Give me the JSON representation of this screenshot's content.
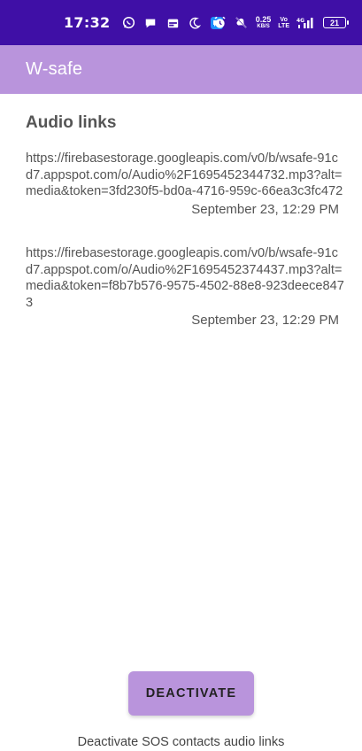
{
  "status_bar": {
    "time": "17:32",
    "net_speed_value": "0.25",
    "net_speed_unit": "KB/S",
    "lte_top": "Vo",
    "lte_bottom": "LTE",
    "signal_label": "4G",
    "battery": "21",
    "icons": [
      "whatsapp-icon",
      "chat-bubble-icon",
      "calendar-icon",
      "moon-icon",
      "message-icon",
      "dot-icon",
      "alarm-icon",
      "mute-icon",
      "signal-icon",
      "battery-icon"
    ]
  },
  "app_bar": {
    "title": "W-safe",
    "color": "#b994dc"
  },
  "main": {
    "section_title": "Audio links",
    "audio_links": [
      {
        "url": "https://firebasestorage.googleapis.com/v0/b/wsafe-91cd7.appspot.com/o/Audio%2F1695452344732.mp3?alt=media&token=3fd230f5-bd0a-4716-959c-66ea3c3fc472",
        "date": "September 23, 12:29 PM"
      },
      {
        "url": "https://firebasestorage.googleapis.com/v0/b/wsafe-91cd7.appspot.com/o/Audio%2F1695452374437.mp3?alt=media&token=f8b7b576-9575-4502-88e8-923deece8473",
        "date": "September 23, 12:29 PM"
      }
    ]
  },
  "footer": {
    "button_label": "DEACTIVATE",
    "caption": "Deactivate SOS contacts audio links"
  },
  "colors": {
    "status_bar": "#3f0fa6",
    "accent": "#b994dc",
    "text": "#555555"
  }
}
